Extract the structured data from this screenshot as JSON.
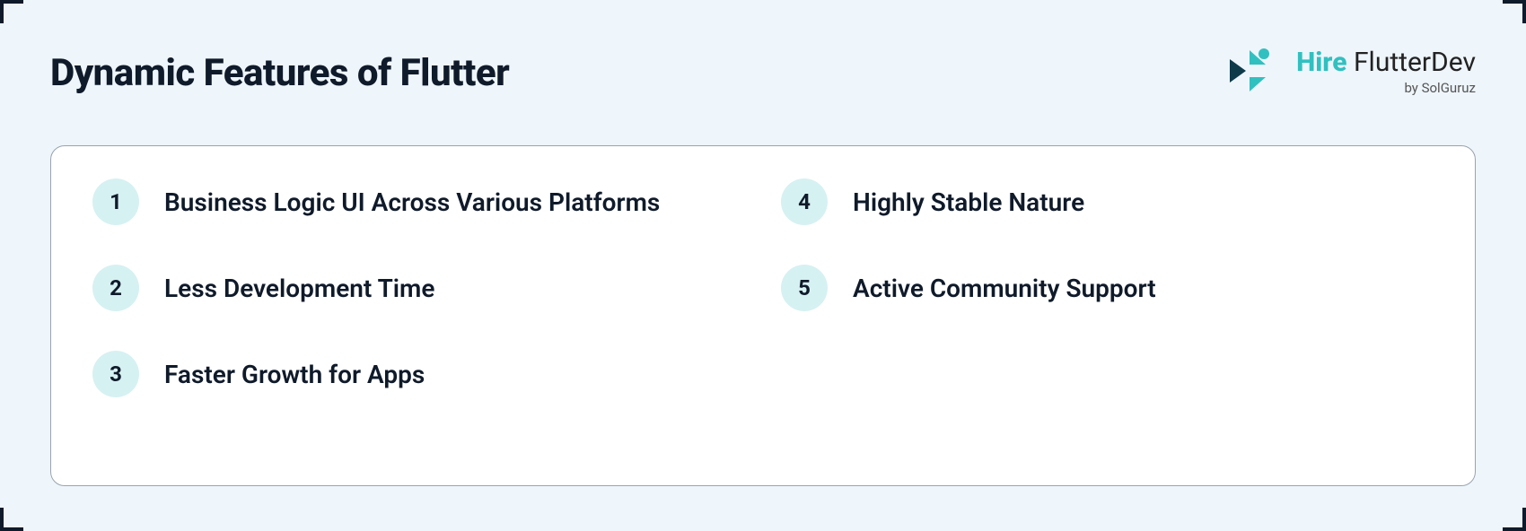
{
  "title": "Dynamic Features of Flutter",
  "brand": {
    "strong": "Hire",
    "light": "FlutterDev",
    "sub": "by SolGuruz"
  },
  "features": [
    {
      "n": "1",
      "label": "Business Logic UI Across Various Platforms"
    },
    {
      "n": "2",
      "label": "Less Development Time"
    },
    {
      "n": "3",
      "label": "Faster Growth for Apps"
    },
    {
      "n": "4",
      "label": "Highly Stable Nature"
    },
    {
      "n": "5",
      "label": "Active Community Support"
    }
  ]
}
